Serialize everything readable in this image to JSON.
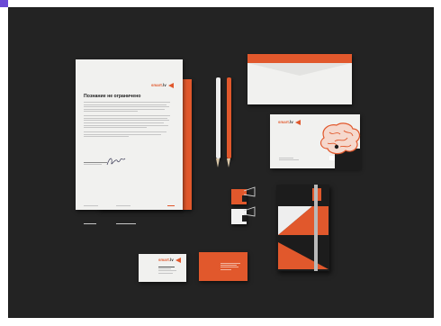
{
  "letterhead": {
    "logo_text": "smart.",
    "logo_suffix": "lv",
    "heading": "Познание не ограничено"
  },
  "envelope_large": {
    "logo_text": "smart.",
    "logo_suffix": "lv"
  },
  "business_card": {
    "logo_text": "smart.",
    "logo_suffix": "lv"
  },
  "colors": {
    "accent": "#e1582c",
    "background": "#232323",
    "paper": "#f1f1ef",
    "dark": "#1c1c1c"
  }
}
